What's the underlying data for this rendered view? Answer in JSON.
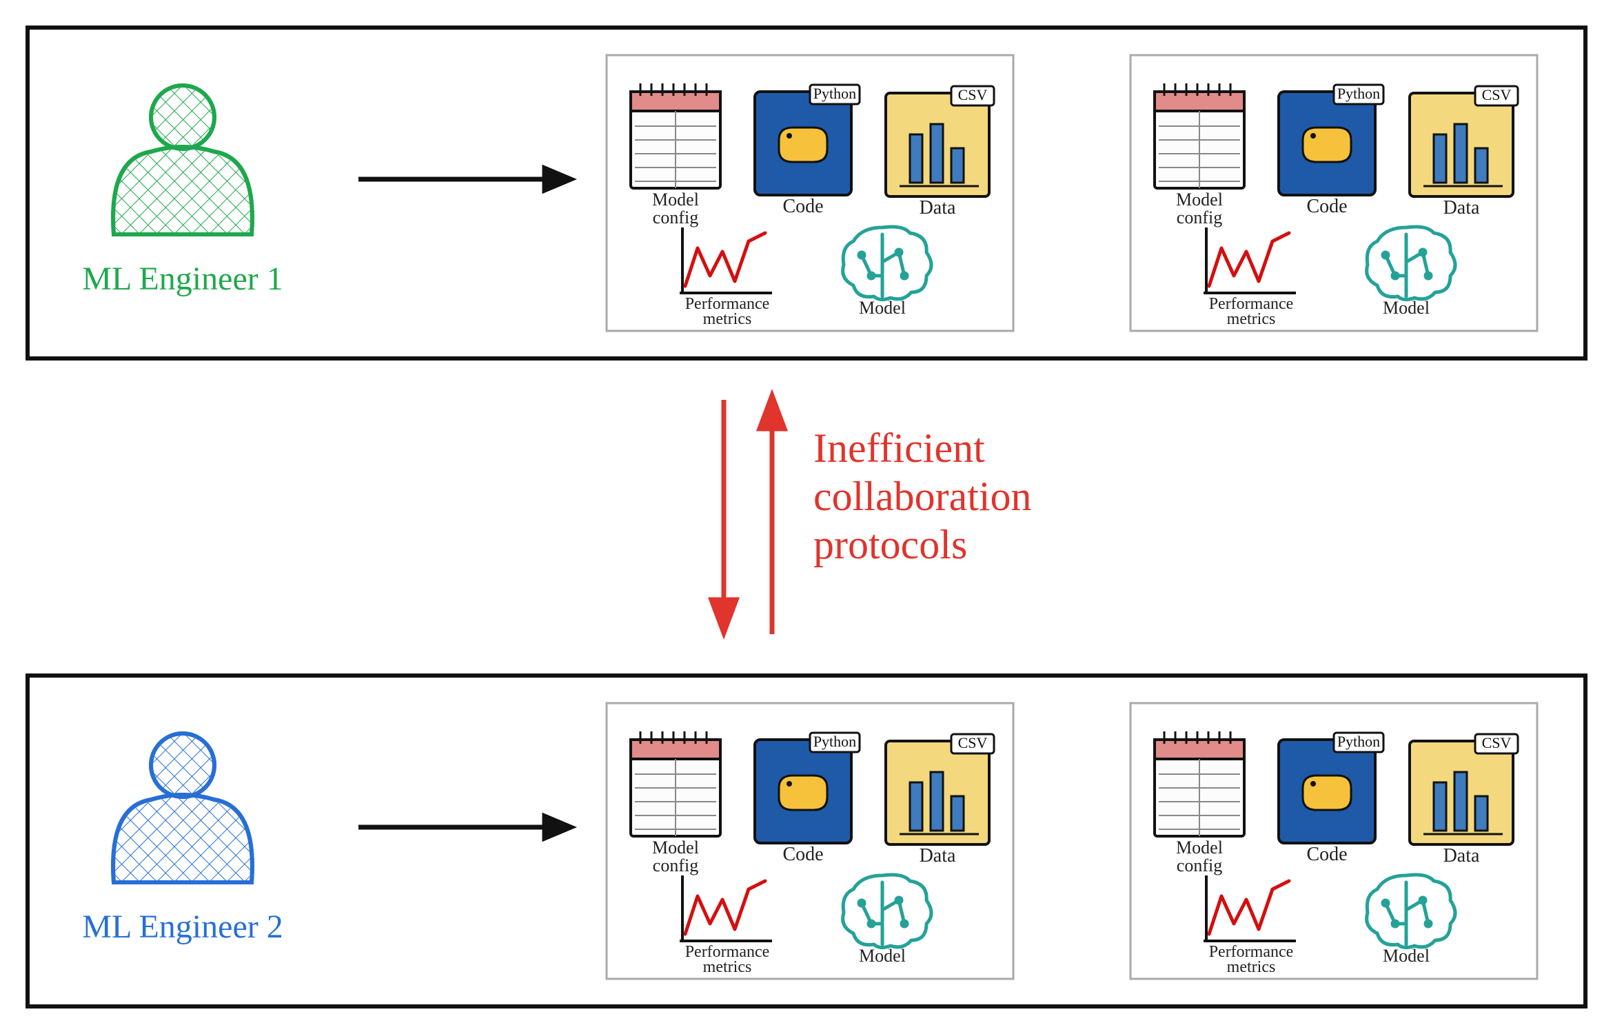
{
  "engineers": [
    {
      "label": "ML Engineer 1",
      "color": "#1ea84d"
    },
    {
      "label": "ML Engineer 2",
      "color": "#276fd6"
    }
  ],
  "center": {
    "lines": [
      "Inefficient",
      "collaboration",
      "protocols"
    ],
    "color": "#e0342c"
  },
  "artifacts": {
    "model_config": "Model\nconfig",
    "code": "Code",
    "code_tag": "Python",
    "data": "Data",
    "data_tag": "CSV",
    "metrics": "Performance\nmetrics",
    "model": "Model"
  },
  "colors": {
    "border": "#111111",
    "artifact_border": "#999999",
    "python_blue": "#1f5aa8",
    "python_yellow": "#f6c13b",
    "csv_yellow": "#f4d87d",
    "csv_blue": "#3e7bbf",
    "pad_pink": "#e28b8b",
    "pad_white": "#fcfcfc",
    "metric_red": "#d40f0f",
    "brain_teal": "#24a298"
  }
}
